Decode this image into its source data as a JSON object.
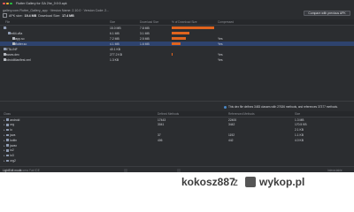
{
  "window": {
    "title": "Flutter Gallery for GA 2he_0:0:0.apk"
  },
  "info": {
    "line1": "gallery.com.Flutter_Gallery_app  ·  Version Name: 2.10.0  ·  Version Code: 2...",
    "line2_prefix": "APK size:",
    "apk_size": "19.4 MB",
    "line2_dl_prefix": "Download Size:",
    "download_size": "17.4 MB"
  },
  "compare_button": "Compare with previous APK",
  "file_table": {
    "headers": {
      "file": "File",
      "size": "Size",
      "download": "Download Size",
      "percent": "% of Download Size",
      "compressed": "Compressed"
    },
    "rows": [
      {
        "name": "lib",
        "indent": 0,
        "expanded": true,
        "type": "folder",
        "size": "15.0 MB",
        "download": "7.8 MB",
        "compressed": "",
        "percent": 60,
        "selected": false
      },
      {
        "name": "arm64-v8a",
        "indent": 1,
        "expanded": true,
        "type": "folder",
        "size": "6.1 MB",
        "download": "3.1 MB",
        "compressed": "",
        "percent": 25,
        "selected": false
      },
      {
        "name": "libapp.so",
        "indent": 2,
        "expanded": false,
        "type": "file",
        "size": "7.2 MB",
        "download": "2.5 MB",
        "compressed": "Yes",
        "percent": 20,
        "selected": false
      },
      {
        "name": "libflutter.so",
        "indent": 2,
        "expanded": false,
        "type": "file",
        "size": "4.1 MB",
        "download": "1.6 MB",
        "compressed": "Yes",
        "percent": 12,
        "selected": true
      },
      {
        "name": "META-INF",
        "indent": 0,
        "expanded": false,
        "type": "folder",
        "size": "40.1 KB",
        "download": "",
        "compressed": "",
        "percent": 0,
        "selected": false
      },
      {
        "name": "classes.dex",
        "indent": 0,
        "expanded": false,
        "type": "file",
        "size": "277.2 KB",
        "download": "",
        "compressed": "Yes",
        "percent": 1,
        "selected": false
      },
      {
        "name": "AndroidManifest.xml",
        "indent": 0,
        "expanded": false,
        "type": "file",
        "size": "1.3 KB",
        "download": "",
        "compressed": "Yes",
        "percent": 0,
        "selected": false
      }
    ]
  },
  "dex_summary": "This dex file defines 3483 classes with 27636 methods, and references 37377 methods.",
  "class_table": {
    "headers": {
      "class": "Class",
      "defined": "Defined Methods",
      "referenced": "Referenced Methods",
      "size": "Size"
    },
    "rows": [
      {
        "name": "android",
        "defined": "17443",
        "referenced": "22400",
        "size": "1.3 MB"
      },
      {
        "name": "org",
        "defined": "3041",
        "referenced": "3442",
        "size": "170.5 KB"
      },
      {
        "name": "io",
        "defined": "",
        "referenced": "",
        "size": "2.1 KB"
      },
      {
        "name": "java",
        "defined": "37",
        "referenced": "1192",
        "size": "1.1 KB"
      },
      {
        "name": "kotlin",
        "defined": "406",
        "referenced": "442",
        "size": "4.0 KB"
      },
      {
        "name": "javax",
        "defined": "",
        "referenced": "",
        "size": ""
      },
      {
        "name": "io2",
        "defined": "",
        "referenced": "",
        "size": ""
      },
      {
        "name": "io3",
        "defined": "",
        "referenced": "",
        "size": ""
      },
      {
        "name": "org2",
        "defined": "",
        "referenced": "",
        "size": ""
      }
    ]
  },
  "statusbar": {
    "left": "LightEdit mode",
    "mid": "Access Fair IDE",
    "right": "Interactable"
  },
  "watermark": {
    "user": "kokosz887",
    "z": "z",
    "site": "wykop.pl"
  },
  "colors": {
    "accent_bar": "#e0641e",
    "selection": "#2e436e",
    "background": "#2b2d30"
  }
}
